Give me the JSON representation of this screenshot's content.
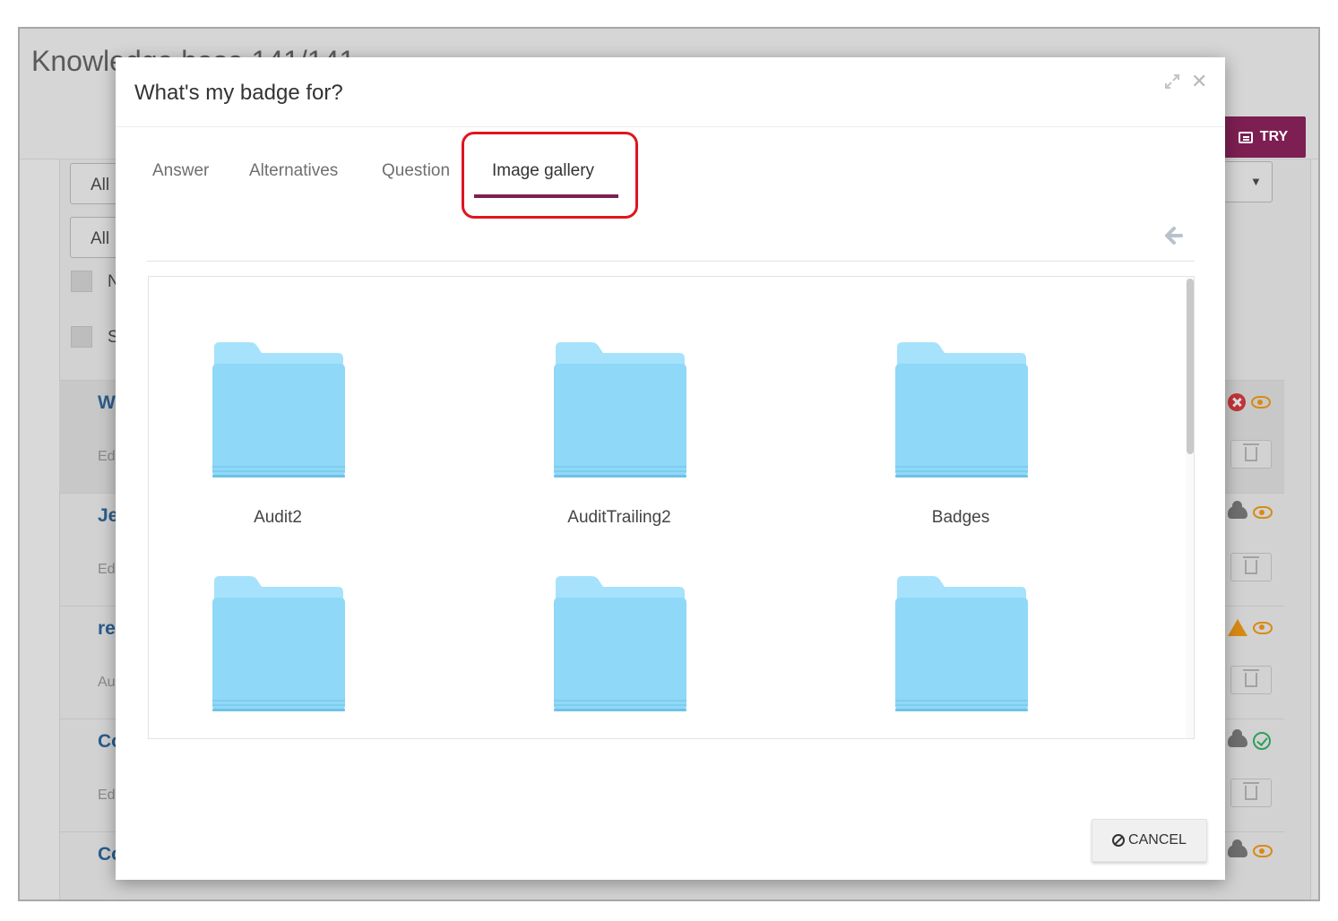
{
  "background": {
    "title": "Knowledge base 141/141",
    "try_label": "TRY",
    "filters": [
      "All",
      "All"
    ],
    "checkboxes": [
      "N",
      "S"
    ],
    "rows": [
      {
        "title": "W",
        "sub": "Ed"
      },
      {
        "title": "Je",
        "sub": "Ed"
      },
      {
        "title": "re",
        "sub": "Au"
      },
      {
        "title": "Co",
        "sub": "Ed"
      },
      {
        "title": "Co",
        "sub": ""
      }
    ]
  },
  "modal": {
    "title": "What's my badge for?",
    "tabs": [
      {
        "label": "Answer"
      },
      {
        "label": "Alternatives"
      },
      {
        "label": "Question"
      },
      {
        "label": "Image gallery",
        "active": true
      }
    ],
    "folders": [
      {
        "name": "Audit2"
      },
      {
        "name": "AuditTrailing2"
      },
      {
        "name": "Badges"
      },
      {
        "name": ""
      },
      {
        "name": ""
      },
      {
        "name": ""
      }
    ],
    "cancel_label": "CANCEL"
  },
  "colors": {
    "accent": "#7d1f52",
    "highlight": "#e0141e",
    "folder": "#8fd8f8"
  }
}
